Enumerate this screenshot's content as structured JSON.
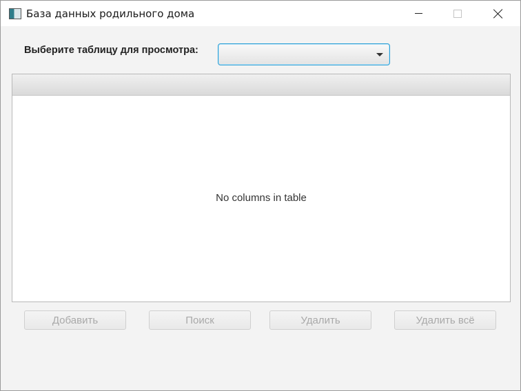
{
  "window": {
    "title": "База данных родильного дома"
  },
  "header": {
    "prompt_label": "Выберите таблицу для просмотра:",
    "table_select": {
      "selected_value": ""
    }
  },
  "table": {
    "placeholder": "No columns in table"
  },
  "actions": {
    "add_label": "Добавить",
    "search_label": "Поиск",
    "delete_label": "Удалить",
    "delete_all_label": "Удалить всё"
  },
  "colors": {
    "focus_accent": "#2a9fd6",
    "window_bg": "#f3f3f3",
    "disabled_text": "#a9a9a9"
  },
  "icons": [
    "app-icon",
    "minimize-icon",
    "maximize-icon",
    "close-icon",
    "chevron-down-icon"
  ]
}
